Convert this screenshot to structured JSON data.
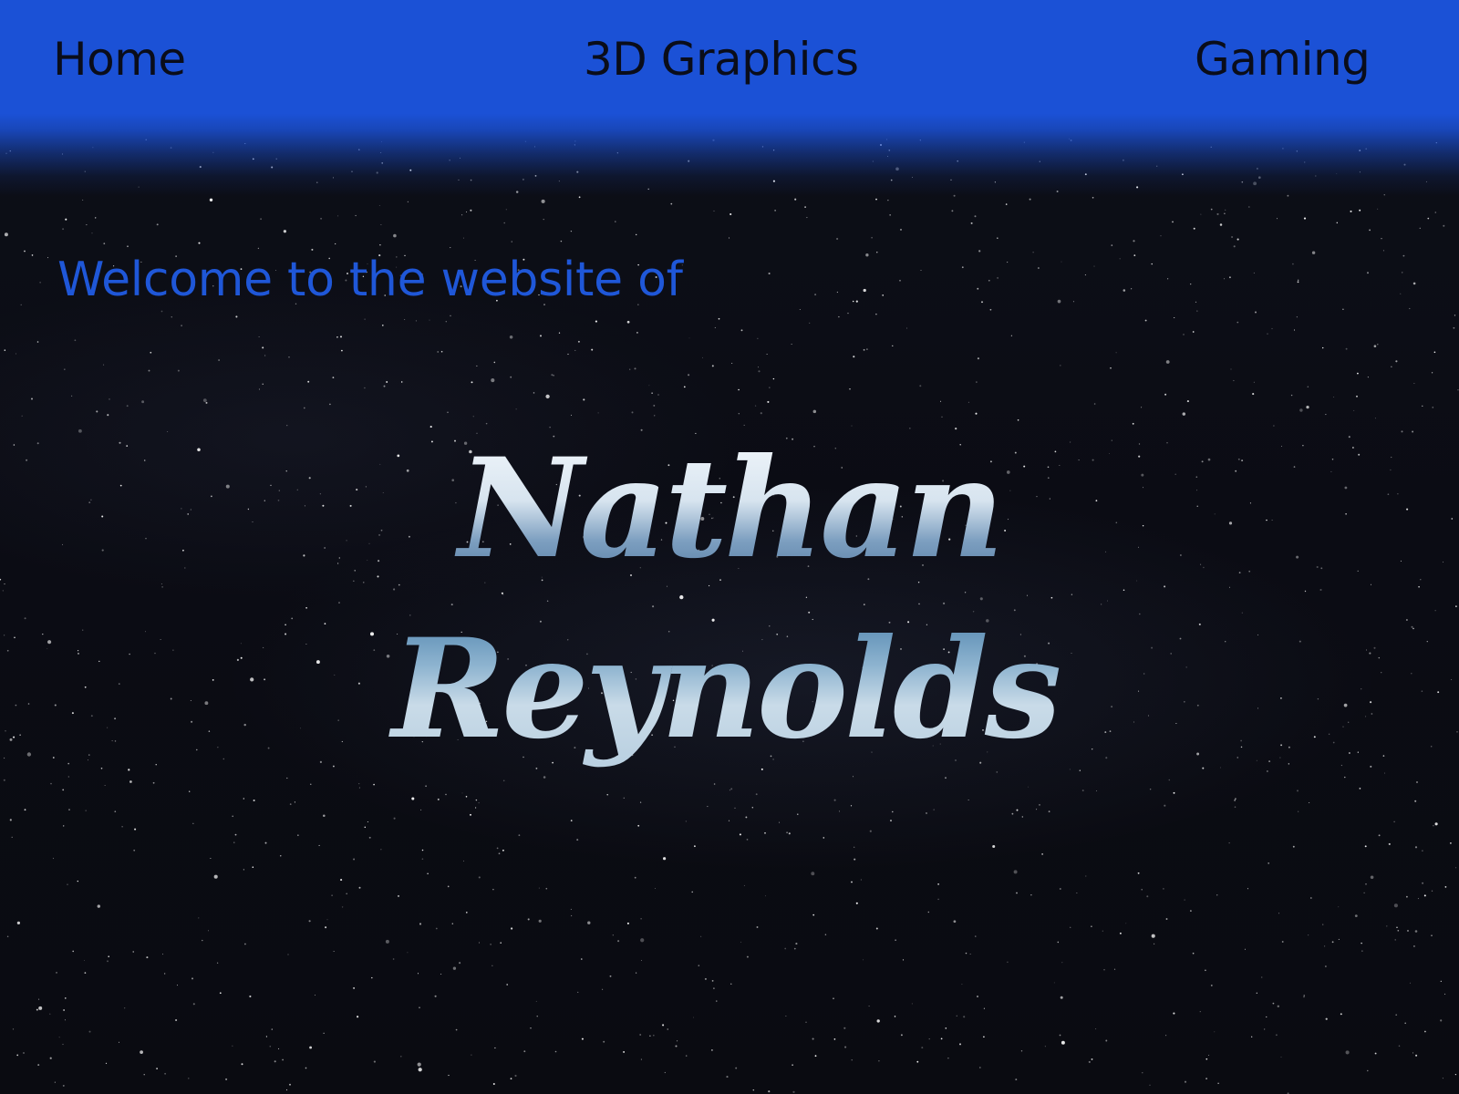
{
  "nav": {
    "items": [
      {
        "label": "Home"
      },
      {
        "label": "3D Graphics"
      },
      {
        "label": "Gaming"
      }
    ]
  },
  "hero": {
    "welcome_text": "Welcome to the website of",
    "name_line1": "Nathan",
    "name_line2": "Reynolds"
  },
  "colors": {
    "navbar": "#1b51d6",
    "welcome_text": "#1f57d8",
    "nav_text": "#0a0d1a",
    "background": "#0b0c13",
    "name_fill_top": "#e9f1f8",
    "name_fill_mid": "#8fb0cf",
    "name_fill_bottom": "#c4d7e6"
  }
}
